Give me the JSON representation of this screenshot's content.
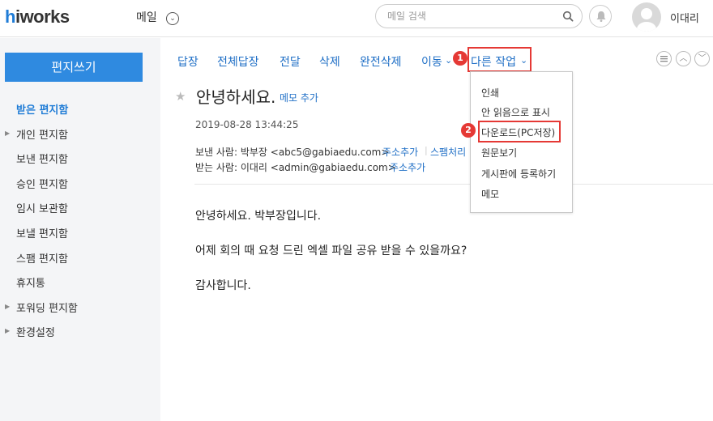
{
  "header": {
    "logo_prefix": "h",
    "logo_rest": "iworks",
    "app_title": "메일",
    "search_placeholder": "메일 검색",
    "user_name": "이대리"
  },
  "sidebar": {
    "compose_label": "편지쓰기",
    "items": [
      {
        "label": "받은 편지함",
        "active": true,
        "expandable": false
      },
      {
        "label": "개인 편지함",
        "active": false,
        "expandable": true
      },
      {
        "label": "보낸 편지함",
        "active": false,
        "expandable": false
      },
      {
        "label": "승인 편지함",
        "active": false,
        "expandable": false
      },
      {
        "label": "임시 보관함",
        "active": false,
        "expandable": false
      },
      {
        "label": "보낼 편지함",
        "active": false,
        "expandable": false
      },
      {
        "label": "스팸 편지함",
        "active": false,
        "expandable": false
      },
      {
        "label": "휴지통",
        "active": false,
        "expandable": false
      },
      {
        "label": "포워딩 편지함",
        "active": false,
        "expandable": true
      },
      {
        "label": "환경설정",
        "active": false,
        "expandable": true
      }
    ]
  },
  "toolbar": {
    "reply": "답장",
    "reply_all": "전체답장",
    "forward": "전달",
    "delete": "삭제",
    "perm_delete": "완전삭제",
    "move": "이동",
    "more_actions": "다른 작업"
  },
  "badges": {
    "one": "1",
    "two": "2"
  },
  "dropdown": {
    "items": [
      "인쇄",
      "안 읽음으로 표시",
      "다운로드(PC저장)",
      "원문보기",
      "게시판에 등록하기",
      "메모"
    ]
  },
  "message": {
    "subject": "안녕하세요.",
    "memo_add": "메모 추가",
    "date": "2019-08-28 13:44:25",
    "from_label": "보낸 사람: 박부장 <abc5@gabiaedu.com>",
    "from_add_contact": "주소추가",
    "from_spam": "스팸처리",
    "to_label": "받는 사람: 이대리 <admin@gabiaedu.com>",
    "to_add_contact": "주소추가",
    "body": [
      "안녕하세요. 박부장입니다.",
      "어제 회의 때 요청 드린 엑셀 파일 공유 받을 수 있을까요?",
      "감사합니다."
    ]
  },
  "colors": {
    "accent": "#2f8ae0",
    "link": "#1f6fc6",
    "highlight": "#e53935",
    "sidebar_bg": "#f4f5f7"
  },
  "icons": [
    "search-icon",
    "bell-icon",
    "chevron-down-icon",
    "star-icon",
    "list-icon",
    "chevron-up-icon"
  ]
}
